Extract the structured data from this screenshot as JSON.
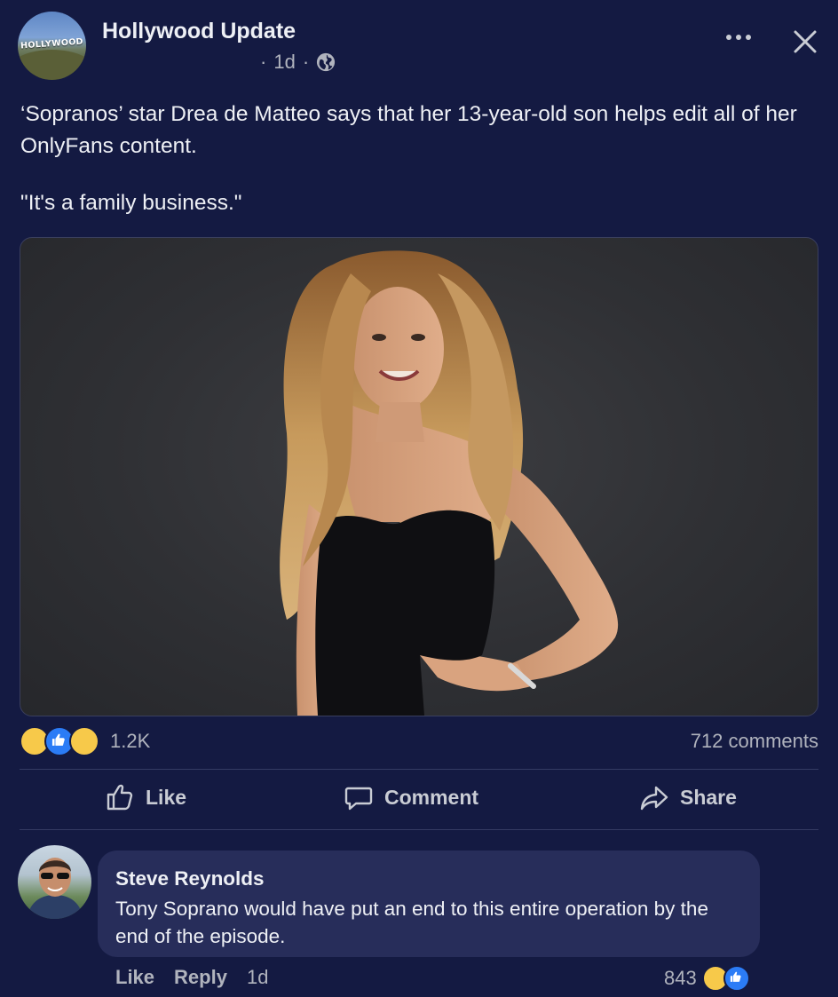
{
  "post": {
    "page_name": "Hollywood Update",
    "avatar_sign": "HOLLYWOOD",
    "time": "1d",
    "separator": "·",
    "text_line1": "‘Sopranos’ star Drea de Matteo says that her 13-year-old son helps edit all of her OnlyFans content.",
    "text_line2": "\"It's a family business.\"",
    "reaction_count": "1.2K",
    "comments_count": "712 comments",
    "reactions": [
      "laugh-emoji",
      "like-emoji",
      "wow-emoji"
    ]
  },
  "actions": {
    "like": "Like",
    "comment": "Comment",
    "share": "Share"
  },
  "comment": {
    "author": "Steve Reynolds",
    "text": "Tony Soprano would have put an end to this entire operation by the end of the episode.",
    "like": "Like",
    "reply": "Reply",
    "time": "1d",
    "reaction_count": "843"
  },
  "colors": {
    "background": "#141a42",
    "bubble": "#272d5a",
    "like_blue": "#2b7cf6",
    "emoji_yellow": "#f7c94a"
  }
}
